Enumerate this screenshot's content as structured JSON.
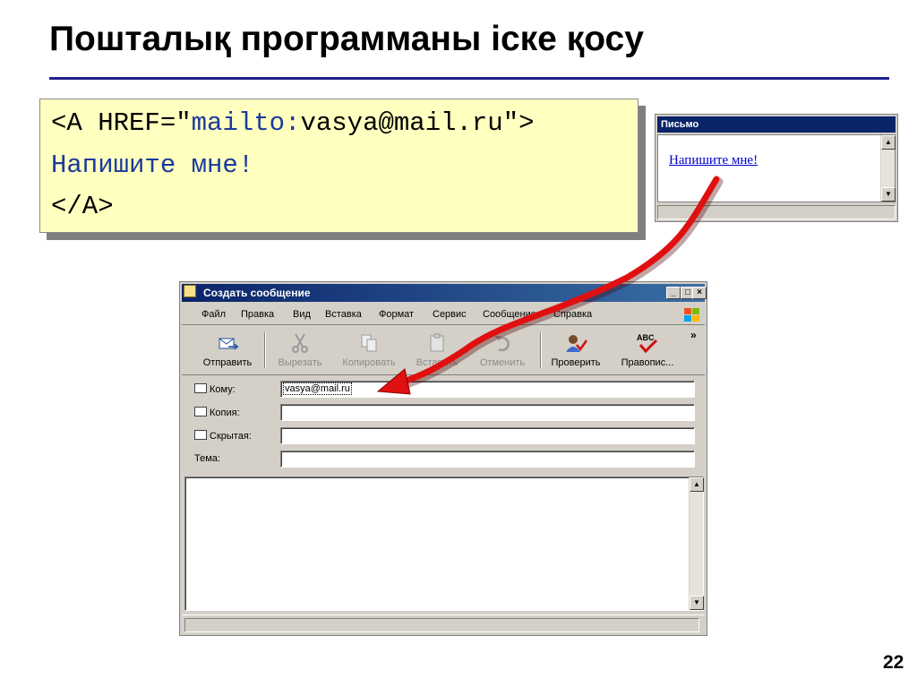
{
  "slide": {
    "title": "Пошталық программаны іске қосу",
    "page_number": "22"
  },
  "code": {
    "line1_a": "<A HREF=\"",
    "line1_b": "mailto:",
    "line1_c": "vasya@mail.ru\">",
    "line2": "Напишите мне!",
    "line3": "</A>"
  },
  "browser_window": {
    "title": "Письмо",
    "link_text": "Напишите мне!"
  },
  "compose_window": {
    "title": "Создать сообщение",
    "menu": [
      "Файл",
      "Правка",
      "Вид",
      "Вставка",
      "Формат",
      "Сервис",
      "Сообщение",
      "Справка"
    ],
    "toolbar": [
      {
        "label": "Отправить",
        "icon": "send-icon",
        "enabled": true
      },
      {
        "label": "Вырезать",
        "icon": "scissors-icon",
        "enabled": false
      },
      {
        "label": "Копировать",
        "icon": "copy-icon",
        "enabled": false
      },
      {
        "label": "Вставить",
        "icon": "paste-icon",
        "enabled": false
      },
      {
        "label": "Отменить",
        "icon": "undo-icon",
        "enabled": false
      },
      {
        "label": "Проверить",
        "icon": "check-names-icon",
        "enabled": true
      },
      {
        "label": "Правопис...",
        "icon": "spelling-icon",
        "enabled": true
      }
    ],
    "toolbar_more": "»",
    "fields": {
      "to_label": "Кому:",
      "to_value": "vasya@mail.ru",
      "cc_label": "Копия:",
      "cc_value": "",
      "bcc_label": "Скрытая:",
      "bcc_value": "",
      "subject_label": "Тема:",
      "subject_value": ""
    },
    "window_buttons": {
      "minimize": "_",
      "maximize": "□",
      "close": "×"
    }
  },
  "scroll_glyphs": {
    "up": "▲",
    "down": "▼"
  },
  "colors": {
    "title_rule": "#1f1f8f",
    "code_background": "#ffffc0",
    "code_blue": "#1a3a9c",
    "arrow": "#e01010",
    "titlebar": "#0a246a"
  }
}
